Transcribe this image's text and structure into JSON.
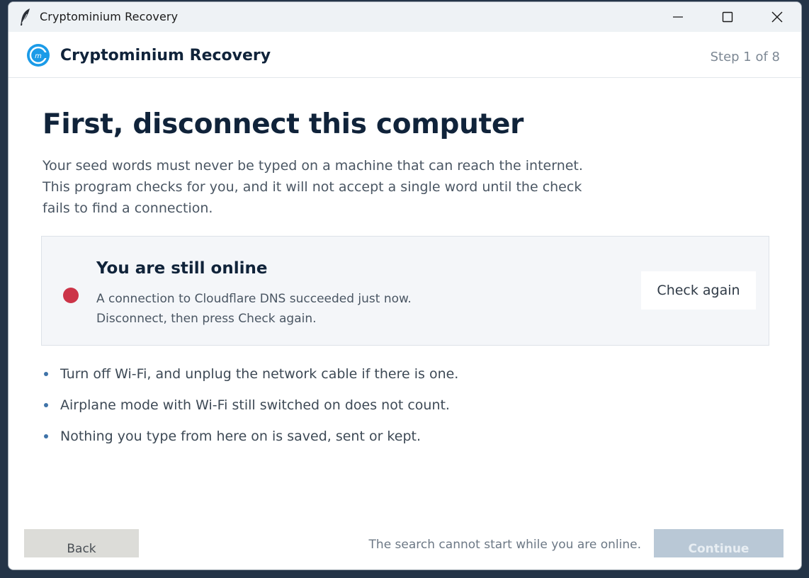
{
  "window": {
    "title": "Cryptominium Recovery",
    "title_icon": "feather-icon",
    "controls": [
      "minimize-icon",
      "maximize-icon",
      "close-icon"
    ]
  },
  "header": {
    "app_name": "Cryptominium Recovery",
    "step": "Step 1 of 8",
    "logo_icon": "cryptominium-logo"
  },
  "main": {
    "heading": "First, disconnect this computer",
    "intro": "Your seed words must never be typed on a machine that can reach the internet. This program checks for you, and it will not accept a single word until the check fails to find a connection.",
    "status": {
      "title": "You are still online",
      "line1": "A connection to Cloudflare DNS succeeded just now.",
      "line2": "Disconnect, then press Check again.",
      "check_button": "Check again",
      "indicator_color": "#cc3448"
    },
    "bullets": [
      "Turn off Wi-Fi, and unplug the network cable if there is one.",
      "Airplane mode with Wi-Fi still switched on does not count.",
      "Nothing you type from here on is saved, sent or kept."
    ]
  },
  "footer": {
    "back_button": "Back",
    "note": "The search cannot start while you are online.",
    "continue_button": "Continue",
    "continue_disabled": true
  },
  "colors": {
    "heading": "#10233a",
    "accent": "#3f73a8",
    "continue_disabled_bg": "#b9c8d6"
  }
}
